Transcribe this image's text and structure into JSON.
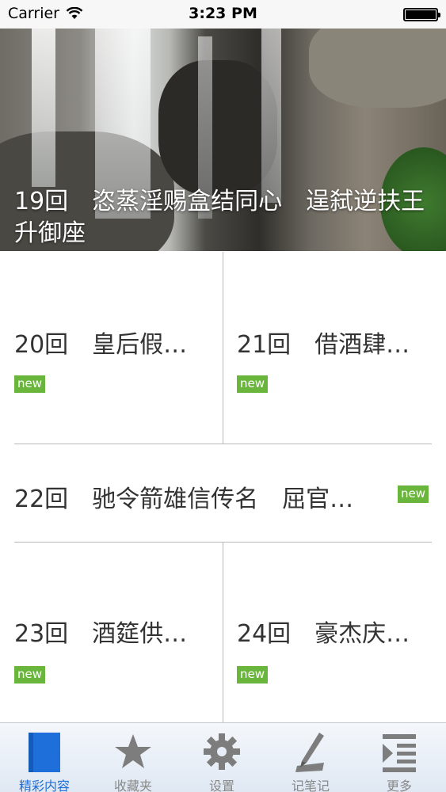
{
  "status_bar": {
    "carrier": "Carrier",
    "time": "3:23 PM"
  },
  "hero": {
    "title": "19回　恣蒸淫赐盒结同心　逞弑逆扶王升御座"
  },
  "items": [
    {
      "title": "20回　皇后假…",
      "badge": "new"
    },
    {
      "title": "21回　借酒肆…",
      "badge": "new"
    },
    {
      "title": "22回　驰令箭雄信传名　屈官…",
      "badge": "new"
    },
    {
      "title": "23回　酒筵供…",
      "badge": "new"
    },
    {
      "title": "24回　豪杰庆…",
      "badge": "new"
    }
  ],
  "tabs": [
    {
      "label": "精彩内容",
      "icon": "book-icon",
      "active": true
    },
    {
      "label": "收藏夹",
      "icon": "star-icon"
    },
    {
      "label": "设置",
      "icon": "gear-icon"
    },
    {
      "label": "记笔记",
      "icon": "pen-icon"
    },
    {
      "label": "更多",
      "icon": "more-icon"
    }
  ],
  "colors": {
    "badge": "#6ab63c",
    "active_tab": "#1e6fd9",
    "divider": "#b8b8b8"
  }
}
